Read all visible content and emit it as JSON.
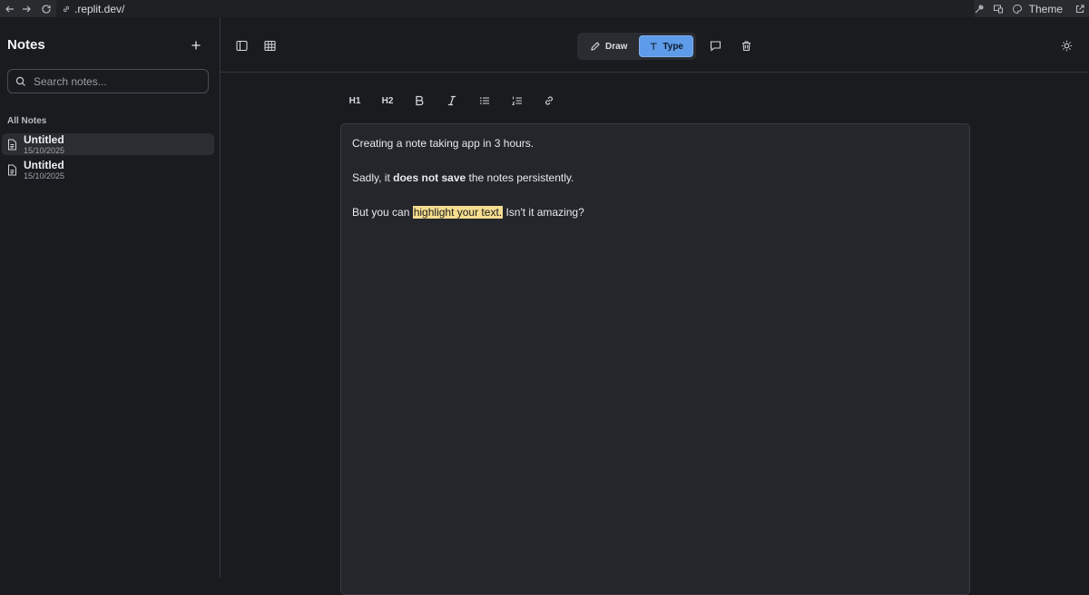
{
  "browser": {
    "url": ".replit.dev/",
    "theme_label": "Theme",
    "icons": [
      "back-arrow-icon",
      "forward-arrow-icon",
      "reload-icon",
      "link-icon",
      "wrench-icon",
      "devices-icon",
      "palette-icon",
      "external-link-icon"
    ]
  },
  "sidebar": {
    "title": "Notes",
    "search_placeholder": "Search notes...",
    "section_label": "All Notes",
    "notes": [
      {
        "title": "Untitled",
        "date": "15/10/2025",
        "active": true
      },
      {
        "title": "Untitled",
        "date": "15/10/2025",
        "active": false
      }
    ]
  },
  "toolbar": {
    "draw_label": "Draw",
    "type_label": "Type",
    "active_mode": "Type",
    "accent_color": "#5e9be8"
  },
  "format_toolbar": {
    "h1_label": "H1",
    "h2_label": "H2"
  },
  "editor": {
    "line1": "Creating a note taking app in 3 hours.",
    "line2_pre": "Sadly, it ",
    "line2_bold": "does not save",
    "line2_post": " the notes persistently.",
    "line3_pre": "But you can ",
    "line3_highlight": "highlight your text.",
    "line3_post": " Isn't it amazing?",
    "highlight_color": "#f5dd8f"
  }
}
